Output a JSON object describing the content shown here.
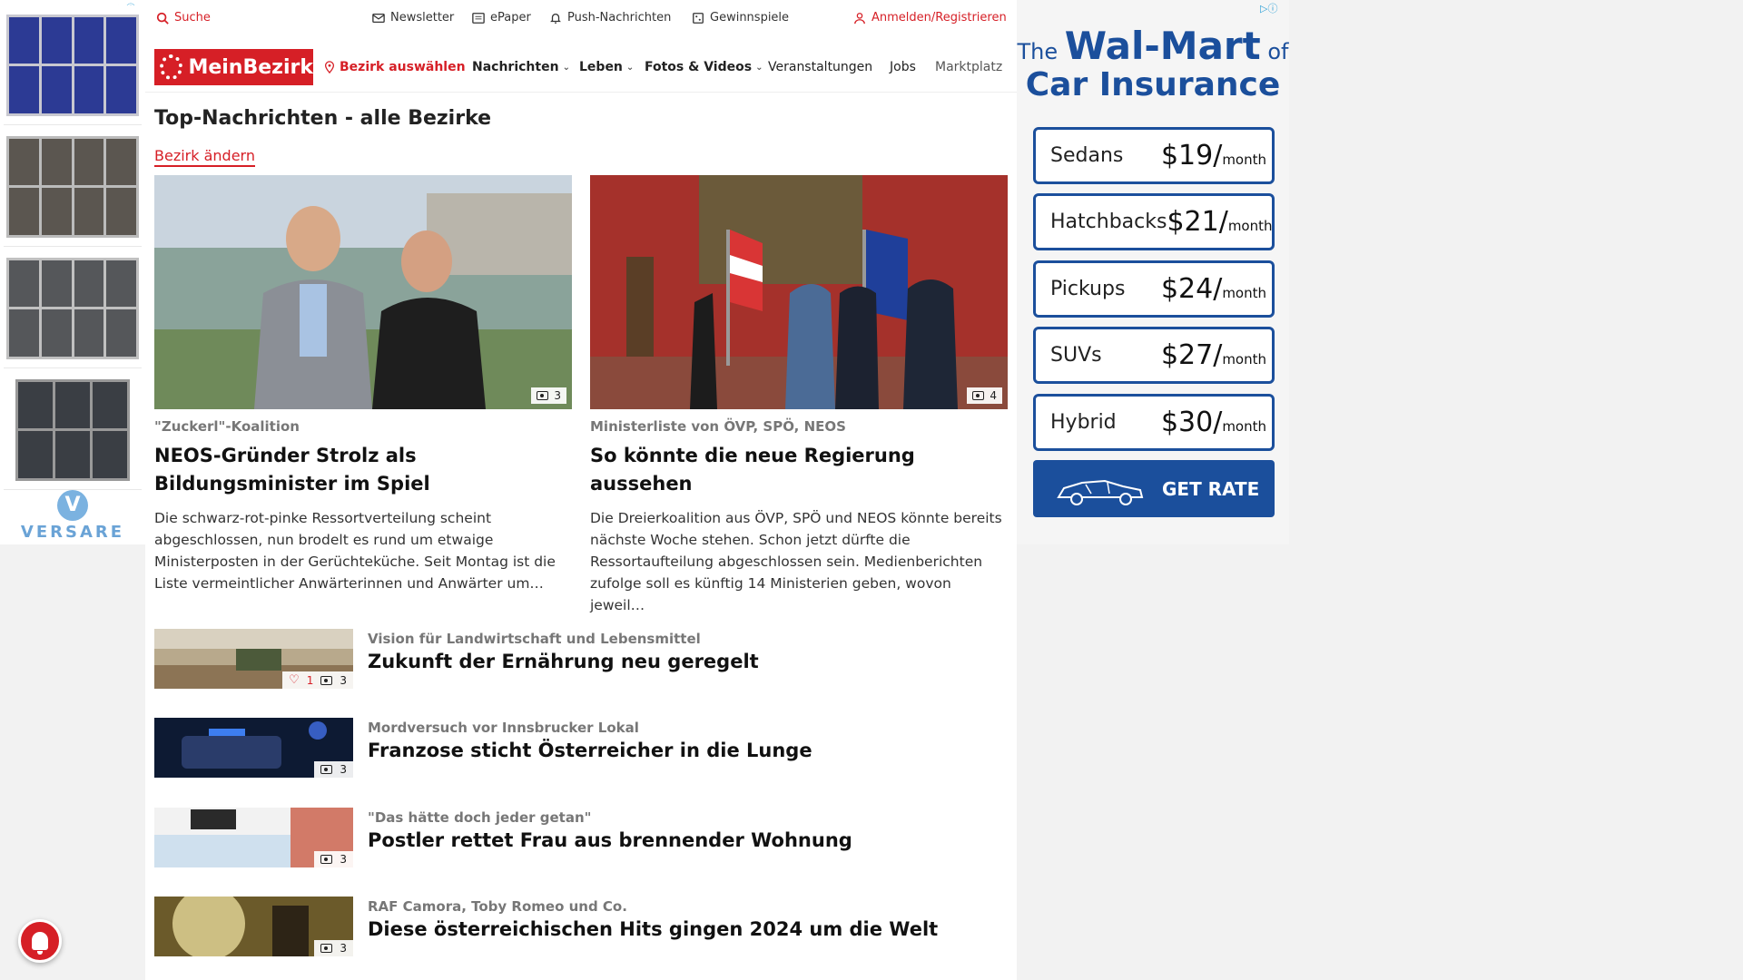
{
  "left_ad": {
    "brand": "VERSARE",
    "logo_letter": "V",
    "adchoice_mark": "▷ⓘ"
  },
  "utility_bar": {
    "search": "Suche",
    "newsletter": "Newsletter",
    "epaper": "ePaper",
    "push": "Push-Nachrichten",
    "games": "Gewinnspiele",
    "login": "Anmelden/Registrieren"
  },
  "nav": {
    "logo": "MeinBezirk",
    "district": "Bezirk auswählen",
    "items": [
      "Nachrichten",
      "Leben",
      "Fotos & Videos",
      "Veranstaltungen",
      "Jobs",
      "Marktplatz"
    ]
  },
  "section": {
    "title": "Top-Nachrichten - alle Bezirke",
    "change_district": "Bezirk ändern"
  },
  "features": [
    {
      "kicker": "\"Zuckerl\"-Koalition",
      "headline": "NEOS-Gründer Strolz als Bildungsminister im Spiel",
      "teaser": "Die schwarz-rot-pinke Ressortverteilung scheint abgeschlossen, nun brodelt es rund um etwaige Ministerposten in der Gerüchteküche. Seit Montag ist die Liste vermeintlicher Anwärterinnen und Anwärter um…",
      "photo_count": "3"
    },
    {
      "kicker": "Ministerliste von ÖVP, SPÖ, NEOS",
      "headline": "So könnte die neue Regierung aussehen",
      "teaser": "Die Dreierkoalition aus ÖVP, SPÖ und NEOS könnte bereits nächste Woche stehen. Schon jetzt dürfte die Ressortaufteilung abgeschlossen sein. Medienberichten zufolge soll es künftig 14 Ministerien geben, wovon jeweil…",
      "photo_count": "4"
    }
  ],
  "list": [
    {
      "kicker": "Vision für Landwirtschaft und Lebensmittel",
      "headline": "Zukunft der Ernährung neu geregelt",
      "likes": "1",
      "photo_count": "3"
    },
    {
      "kicker": "Mordversuch vor Innsbrucker Lokal",
      "headline": "Franzose sticht Österreicher in die Lunge",
      "photo_count": "3"
    },
    {
      "kicker": "\"Das hätte doch jeder getan\"",
      "headline": "Postler rettet Frau aus brennender Wohnung",
      "photo_count": "3"
    },
    {
      "kicker": "RAF Camora, Toby Romeo und Co.",
      "headline": "Diese österreichischen Hits gingen 2024 um die Welt",
      "photo_count": "3"
    }
  ],
  "right_ad": {
    "title_the": "The",
    "title_brand": "Wal-Mart",
    "title_of": "of",
    "title_line2": "Car Insurance",
    "adchoice_mark": "▷ⓘ",
    "rates": [
      {
        "category": "Sedans",
        "price": "$19",
        "unit": "month"
      },
      {
        "category": "Hatchbacks",
        "price": "$21",
        "unit": "month"
      },
      {
        "category": "Pickups",
        "price": "$24",
        "unit": "month"
      },
      {
        "category": "SUVs",
        "price": "$27",
        "unit": "month"
      },
      {
        "category": "Hybrid",
        "price": "$30",
        "unit": "month"
      }
    ],
    "cta": "GET RATE"
  },
  "colors": {
    "brand_red": "#d61f26",
    "ad_blue": "#1b4f9c"
  }
}
